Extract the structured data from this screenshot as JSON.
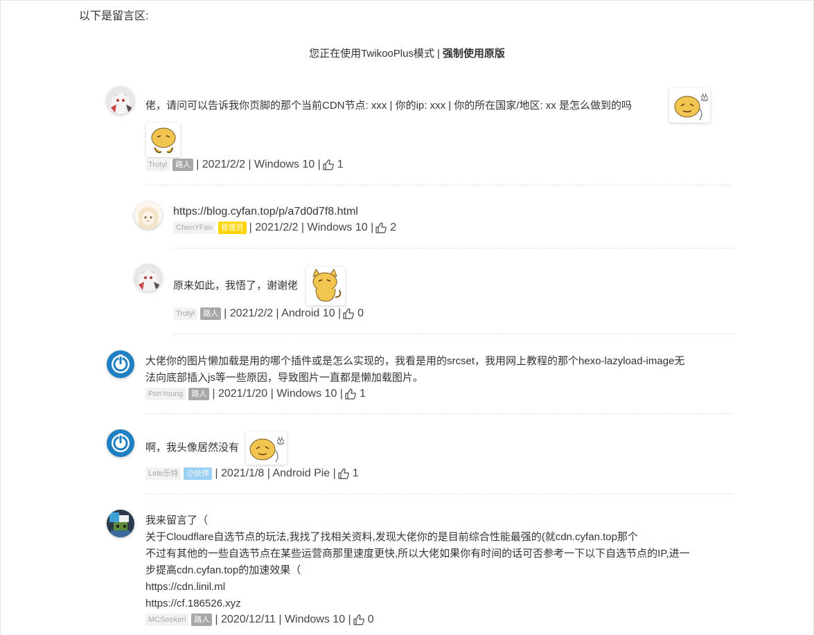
{
  "section_label": "以下是留言区:",
  "mode": {
    "text": "您正在使用TwikooPlus模式",
    "separator": "|",
    "force_link": "强制使用原版"
  },
  "comments": [
    {
      "text": "佬，请问可以告诉我你页脚的那个当前CDN节点: xxx | 你的ip: xxx | 你的所在国家/地区: xx 是怎么做到的吗",
      "nick": "Trotyl",
      "badge": "路人",
      "meta": "| 2021/2/2 | Windows 10 |",
      "likes": "1",
      "avatar_icon": "anime-avatar-icon"
    },
    {
      "text": "https://blog.cyfan.top/p/a7d0d7f8.html",
      "nick": "ChenYFan",
      "badge": "管理员",
      "meta": "| 2021/2/2 | Windows 10 |",
      "likes": "2",
      "avatar_icon": "anime-girl-avatar-icon"
    },
    {
      "text": "原来如此，我悟了，谢谢佬",
      "nick": "Trotyl",
      "badge": "路人",
      "meta": "| 2021/2/2 | Android 10 |",
      "likes": "0",
      "avatar_icon": "anime-avatar-icon"
    },
    {
      "text_line1": "大佬你的图片懒加载是用的哪个插件或是怎么实现的，我看是用的srcset，我用网上教程的那个hexo-lazyload-image无",
      "text_line2": "法向底部插入js等一些原因，导致图片一直都是懒加载图片。",
      "nick": "PonYoung",
      "badge": "路人",
      "meta": "| 2021/1/20 | Windows 10 |",
      "likes": "1",
      "avatar_icon": "power-avatar-icon"
    },
    {
      "text": "啊，我头像居然没有",
      "nick": "Lete乐特",
      "badge": "小伙伴",
      "meta": "| 2021/1/8 | Android Pie |",
      "likes": "1",
      "avatar_icon": "power-avatar-icon"
    },
    {
      "lines": [
        "我来留言了（",
        "关于Cloudflare自选节点的玩法,我找了找相关资料,发现大佬你的是目前综合性能最强的(就cdn.cyfan.top那个",
        "不过有其他的一些自选节点在某些运营商那里速度更快,所以大佬如果你有时间的话可否参考一下以下自选节点的IP,进一",
        "步提高cdn.cyfan.top的加速效果（",
        "https://cdn.linil.ml",
        "https://cf.186526.xyz"
      ],
      "nick": "MCSeekeri",
      "badge": "路人",
      "meta": "| 2020/12/11 | Windows 10 |",
      "likes": "0",
      "avatar_icon": "pixel-avatar-icon"
    }
  ],
  "colors": {
    "guest_badge": "#a8a8a8",
    "admin_badge": "#ffd500",
    "buddy_badge": "#9bd1f5",
    "power_avatar": "#1e7fc2"
  }
}
